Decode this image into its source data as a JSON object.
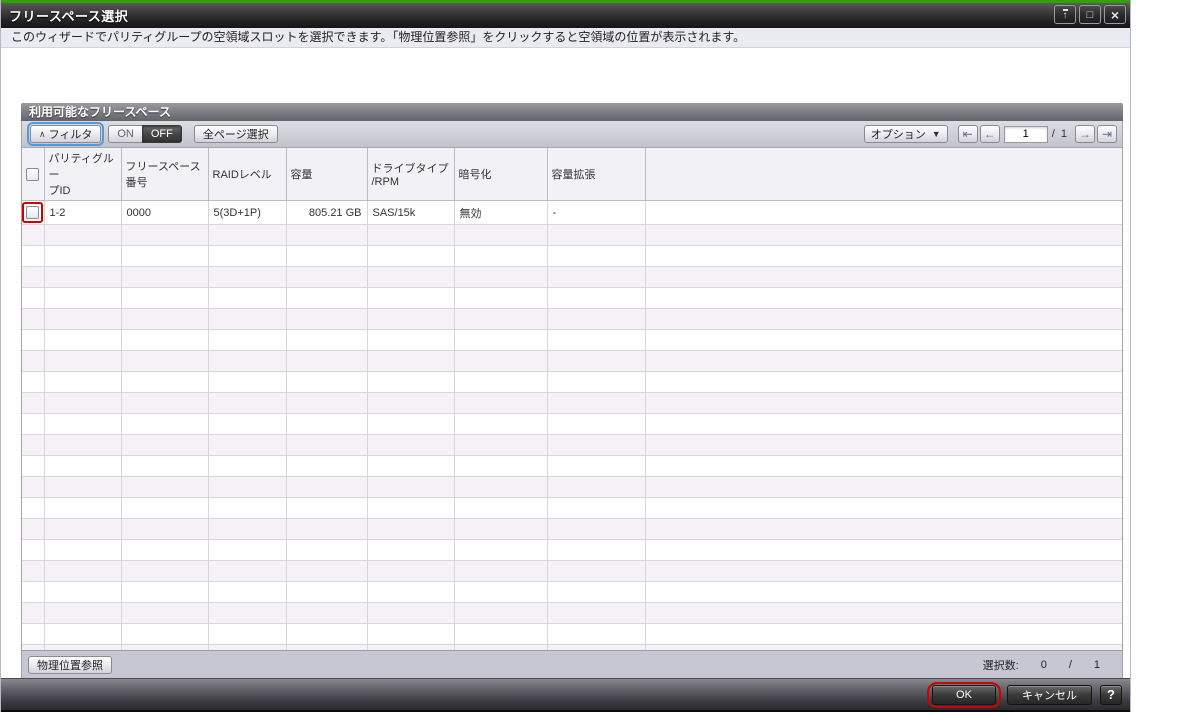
{
  "window": {
    "title": "フリースペース選択",
    "subtitle": "このウィザードでパリティグループの空領域スロットを選択できます。「物理位置参照」をクリックすると空領域の位置が表示されます。",
    "controls": {
      "rollup_icon": "↑",
      "maximize_icon": "□",
      "close_icon": "×"
    }
  },
  "panel": {
    "title": "利用可能なフリースペース",
    "toolbar": {
      "filter_label": "フィルタ",
      "filter_icon": "∧",
      "on_label": "ON",
      "off_label": "OFF",
      "select_all_pages_label": "全ページ選択",
      "options_label": "オプション",
      "options_arrow_icon": "▼",
      "pagination": {
        "first_icon": "⇤",
        "prev_icon": "←",
        "next_icon": "→",
        "last_icon": "⇥",
        "current_page": "1",
        "page_separator": "/",
        "total_pages": "1"
      }
    },
    "table": {
      "columns": [
        {
          "label": "パリティグルー\nプID"
        },
        {
          "label": "フリースペース\n番号"
        },
        {
          "label": "RAIDレベル"
        },
        {
          "label": "容量"
        },
        {
          "label": "ドライブタイプ\n/RPM"
        },
        {
          "label": "暗号化"
        },
        {
          "label": "容量拡張"
        }
      ],
      "rows": [
        {
          "parity_group_id": "1-2",
          "free_space_number": "0000",
          "raid_level": "5(3D+1P)",
          "capacity": "805.21 GB",
          "drive_type_rpm": "SAS/15k",
          "encryption": "無効",
          "capacity_expansion": "-"
        }
      ],
      "empty_row_count": 23
    },
    "bottom": {
      "physical_location_label": "物理位置参照",
      "selected_count_label": "選択数:",
      "selected_count": "0",
      "selected_separator": "/",
      "selected_total": "1"
    }
  },
  "footer": {
    "ok_label": "OK",
    "cancel_label": "キャンセル",
    "help_label": "?"
  },
  "colors": {
    "top_accent_green": "#2fa302",
    "annotation_red": "#cc0000",
    "focus_ring_blue": "#4f9bdf",
    "alt_row_pink": "#f6f1f6",
    "titlebar_dark": "#232323"
  }
}
